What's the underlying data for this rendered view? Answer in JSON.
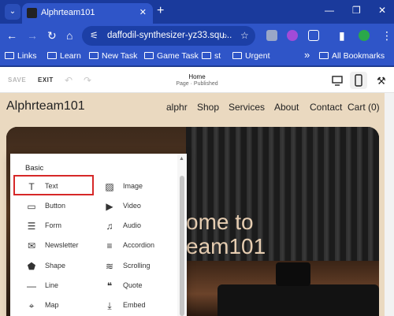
{
  "browser": {
    "tab_title": "Alphrteam101",
    "tab_close": "✕",
    "new_tab": "+",
    "menu_caret": "⌄",
    "window_controls": {
      "minimize": "—",
      "restore": "❐",
      "close": "✕"
    },
    "url": "daffodil-synthesizer-yz33.squ...",
    "icons": {
      "back": "←",
      "forward": "→",
      "reload": "↻",
      "home": "⌂",
      "site_info": "⚟",
      "zoom": "⌕",
      "star": "☆",
      "sidebar": "▮",
      "menu": "⋮"
    }
  },
  "bookmarks": {
    "items": [
      "Links",
      "Learn",
      "New Task",
      "Game Task",
      "st",
      "Urgent"
    ],
    "overflow": "»",
    "all": "All Bookmarks"
  },
  "editor": {
    "save_label": "SAVE",
    "exit_label": "EXIT",
    "undo": "↶",
    "redo": "↷",
    "page_name": "Home",
    "page_status": "Page · Published",
    "style_icon": "⚒"
  },
  "site": {
    "logo": "Alphrteam101",
    "nav": [
      "alphr",
      "Shop",
      "Services",
      "About",
      "Contact",
      "Cart (0)"
    ],
    "hero_title": "ome to\neam101"
  },
  "block_panel": {
    "heading": "Basic",
    "scroll_up": "▲",
    "left_items": [
      {
        "label": "Text",
        "icon": "T"
      },
      {
        "label": "Button",
        "icon": "▭"
      },
      {
        "label": "Form",
        "icon": "☰"
      },
      {
        "label": "Newsletter",
        "icon": "✉"
      },
      {
        "label": "Shape",
        "icon": "⬟"
      },
      {
        "label": "Line",
        "icon": "—"
      },
      {
        "label": "Map",
        "icon": "⌖"
      }
    ],
    "right_items": [
      {
        "label": "Image",
        "icon": "▨"
      },
      {
        "label": "Video",
        "icon": "▶"
      },
      {
        "label": "Audio",
        "icon": "♫"
      },
      {
        "label": "Accordion",
        "icon": "≡"
      },
      {
        "label": "Scrolling",
        "icon": "≋"
      },
      {
        "label": "Quote",
        "icon": "❝"
      },
      {
        "label": "Embed",
        "icon": "⤓"
      }
    ]
  },
  "colors": {
    "browser_blue": "#2f55c8",
    "site_bg": "#ead9c0",
    "highlight": "#d62828"
  }
}
